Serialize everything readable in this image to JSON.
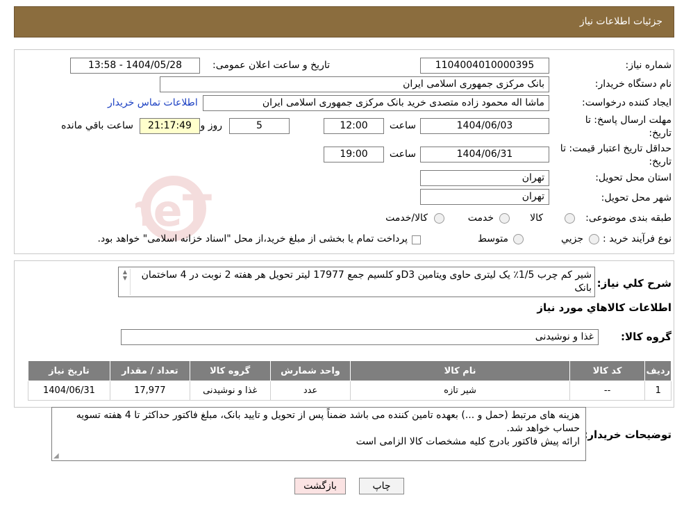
{
  "header": {
    "title": "جزئیات اطلاعات نیاز"
  },
  "form": {
    "need_number_label": "شماره نیاز:",
    "need_number": "1104004010000395",
    "announce_label": "تاریخ و ساعت اعلان عمومی:",
    "announce_value": "1404/05/28 - 13:58",
    "buyer_org_label": "نام دستگاه خریدار:",
    "buyer_org": "بانک مرکزی جمهوری اسلامی ایران",
    "creator_label": "ایجاد کننده درخواست:",
    "creator": "ماشا اله محمود زاده متصدی خرید بانک مرکزی جمهوری اسلامی ایران",
    "contact_link": "اطلاعات تماس خریدار",
    "deadline_label": "مهلت ارسال پاسخ: تا تاریخ:",
    "deadline_date": "1404/06/03",
    "time_label": "ساعت",
    "deadline_time": "12:00",
    "days_value": "5",
    "days_label": "روز و",
    "remaining_time": "21:17:49",
    "remaining_label": "ساعت باقي مانده",
    "validity_label": "حداقل تاریخ اعتبار قیمت: تا تاریخ:",
    "validity_date": "1404/06/31",
    "validity_time": "19:00",
    "province_label": "استان محل تحویل:",
    "province": "تهران",
    "city_label": "شهر محل تحویل:",
    "city": "تهران",
    "category_label": "طبقه بندی موضوعی:",
    "category_options": [
      "کالا",
      "خدمت",
      "کالا/خدمت"
    ],
    "process_label": "نوع فرآیند خرید :",
    "process_options": [
      "جزیي",
      "متوسط"
    ],
    "process_note": "پرداخت تمام یا بخشی از مبلغ خرید،از محل \"اسناد خزانه اسلامی\" خواهد بود."
  },
  "description": {
    "label": "شرح کلي نیاز:",
    "text": "شیر کم چرب 1/5٪ یک لیتری حاوی ویتامین D3و کلسیم جمع 17977 لیتر تحویل هر هفته 2 نوبت در 4 ساختمان بانک"
  },
  "goods": {
    "section_title": "اطلاعات کالاهاي مورد نیاز",
    "group_label": "گروه کالا:",
    "group_value": "غذا و نوشیدنی"
  },
  "table": {
    "headers": [
      "ردیف",
      "کد کالا",
      "نام کالا",
      "واحد شمارش",
      "گروه کالا",
      "تعداد / مقدار",
      "تاریخ نیاز"
    ],
    "rows": [
      [
        "1",
        "--",
        "شیر تازه",
        "عدد",
        "غذا و نوشیدنی",
        "17,977",
        "1404/06/31"
      ]
    ]
  },
  "buyer_notes": {
    "label": "توضیحات خریدار:",
    "line1": "هزینه های مرتبط (حمل و ...) بعهده تامین کننده می باشد ضمناً پس از تحویل و تایید بانک، مبلغ فاکتور حداکثر تا 4 هفته تسویه حساب خواهد شد.",
    "line2": "ارائه پیش فاکتور بادرج کلیه مشخصات کالا الزامی است"
  },
  "buttons": {
    "print": "چاپ",
    "back": "بازگشت"
  },
  "watermark": {
    "brand": "AriaTender.neT"
  },
  "colors": {
    "header_bg": "#8b6d3e",
    "table_header_bg": "#7f7f7f",
    "highlight_yellow": "#ffffcc",
    "back_button_bg": "#fbe3e3"
  }
}
